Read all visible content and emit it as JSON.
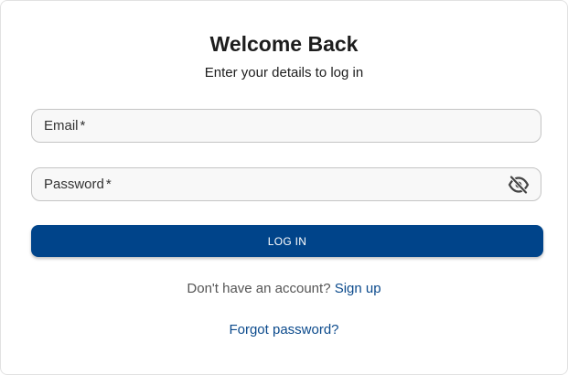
{
  "header": {
    "title": "Welcome Back",
    "subtitle": "Enter your details to log in"
  },
  "form": {
    "email": {
      "label": "Email",
      "required_marker": "*",
      "value": ""
    },
    "password": {
      "label": "Password",
      "required_marker": "*",
      "value": "",
      "visibility_icon": "eye-off-icon"
    },
    "submit_label": "LOG IN"
  },
  "footer": {
    "signup_prompt": "Don't have an account?",
    "signup_link": "Sign up",
    "forgot_link": "Forgot password?"
  },
  "colors": {
    "primary": "#00448a",
    "link": "#0b4a8c",
    "field_bg": "#f8f8f8",
    "field_border": "#c4c4c4"
  }
}
